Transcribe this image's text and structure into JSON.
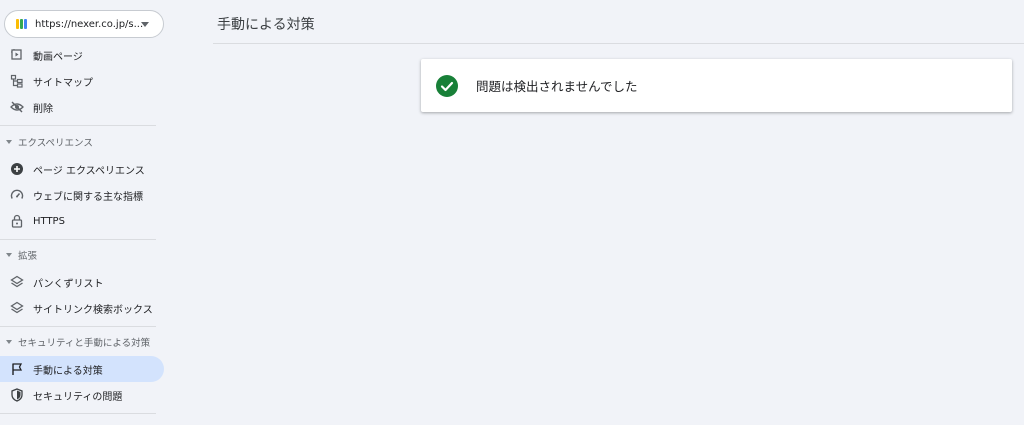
{
  "property": {
    "url": "https://nexer.co.jp/s...",
    "logo_colors": [
      "#fbbc04",
      "#34a853",
      "#4285f4"
    ]
  },
  "sidebar": {
    "top_items": [
      {
        "label": "動画ページ",
        "icon": "video-page-icon"
      },
      {
        "label": "サイトマップ",
        "icon": "sitemap-icon"
      },
      {
        "label": "削除",
        "icon": "hidden-eye-icon"
      }
    ],
    "sections": [
      {
        "label": "エクスペリエンス",
        "items": [
          {
            "label": "ページ エクスペリエンス",
            "icon": "plus-circle-icon"
          },
          {
            "label": "ウェブに関する主な指標",
            "icon": "speedometer-icon"
          },
          {
            "label": "HTTPS",
            "icon": "lock-icon"
          }
        ]
      },
      {
        "label": "拡張",
        "items": [
          {
            "label": "パンくずリスト",
            "icon": "layers-icon"
          },
          {
            "label": "サイトリンク検索ボックス",
            "icon": "layers-icon"
          }
        ]
      },
      {
        "label": "セキュリティと手動による対策",
        "items": [
          {
            "label": "手動による対策",
            "icon": "flag-icon",
            "active": true
          },
          {
            "label": "セキュリティの問題",
            "icon": "shield-icon"
          }
        ]
      }
    ]
  },
  "header": {
    "title": "手動による対策"
  },
  "status_card": {
    "message": "問題は検出されませんでした",
    "icon": "check-circle-icon",
    "color": "#188038"
  },
  "colors": {
    "active_bg": "#d3e3fd",
    "page_bg": "#f1f3f8"
  }
}
